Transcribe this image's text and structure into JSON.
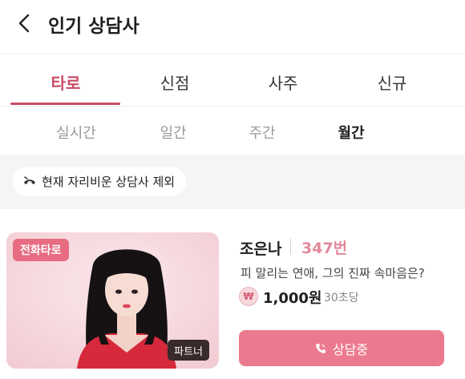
{
  "header": {
    "title": "인기 상담사",
    "back_icon": "chevron-left-icon"
  },
  "category_tabs": [
    {
      "label": "타로",
      "active": true
    },
    {
      "label": "신점",
      "active": false
    },
    {
      "label": "사주",
      "active": false
    },
    {
      "label": "신규",
      "active": false
    }
  ],
  "period_tabs": [
    {
      "label": "실시간",
      "active": false
    },
    {
      "label": "일간",
      "active": false
    },
    {
      "label": "주간",
      "active": false
    },
    {
      "label": "월간",
      "active": true
    }
  ],
  "filter": {
    "label": "현재 자리비운 상담사 제외",
    "icon": "away-phone-icon"
  },
  "counselor": {
    "badge": "전화타로",
    "partner_badge": "파트너",
    "name": "조은나",
    "code": "347번",
    "tagline": "피 말리는 연애, 그의 진짜 속마음은?",
    "coin_symbol": "₩",
    "price": "1,000원",
    "price_unit": "30초당",
    "button_label": "상담중",
    "button_icon": "phone-icon"
  },
  "colors": {
    "accent": "#c94b66",
    "button": "#ec7a8e",
    "code": "#e3899a",
    "badge": "#e86c82"
  }
}
